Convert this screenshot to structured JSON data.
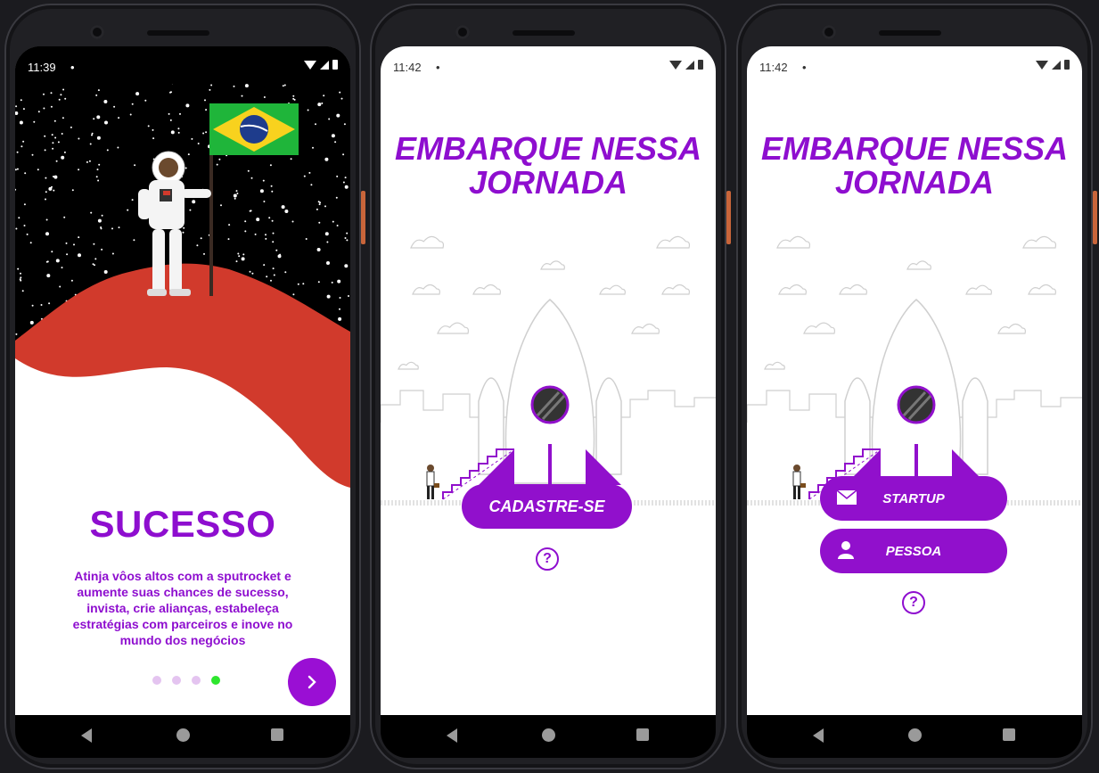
{
  "screens": [
    {
      "status": {
        "time": "11:39",
        "dot": "•"
      },
      "title": "SUCESSO",
      "description": "Atinja vôos altos com a sputrocket e aumente suas chances de sucesso, invista, crie alianças, estabeleça estratégias com parceiros e inove no mundo dos negócios",
      "pagination": {
        "total": 4,
        "active_index": 3
      },
      "next_icon": "chevron-right-icon"
    },
    {
      "status": {
        "time": "11:42",
        "dot": "•"
      },
      "headline": "EMBARQUE NESSA JORNADA",
      "signup_label": "CADASTRE-SE",
      "help_icon": "question-circle-icon",
      "help_glyph": "?"
    },
    {
      "status": {
        "time": "11:42",
        "dot": "•"
      },
      "headline": "EMBARQUE NESSA JORNADA",
      "startup_label": "STARTUP",
      "startup_icon": "envelope-icon",
      "person_label": "PESSOA",
      "person_icon": "person-icon",
      "help_icon": "question-circle-icon",
      "help_glyph": "?"
    }
  ],
  "colors": {
    "accent": "#8e0ecf",
    "button": "#9110cc",
    "planet": "#d13a2c",
    "active_dot": "#2ee62e",
    "inactive_dot": "#e4c4f0"
  }
}
